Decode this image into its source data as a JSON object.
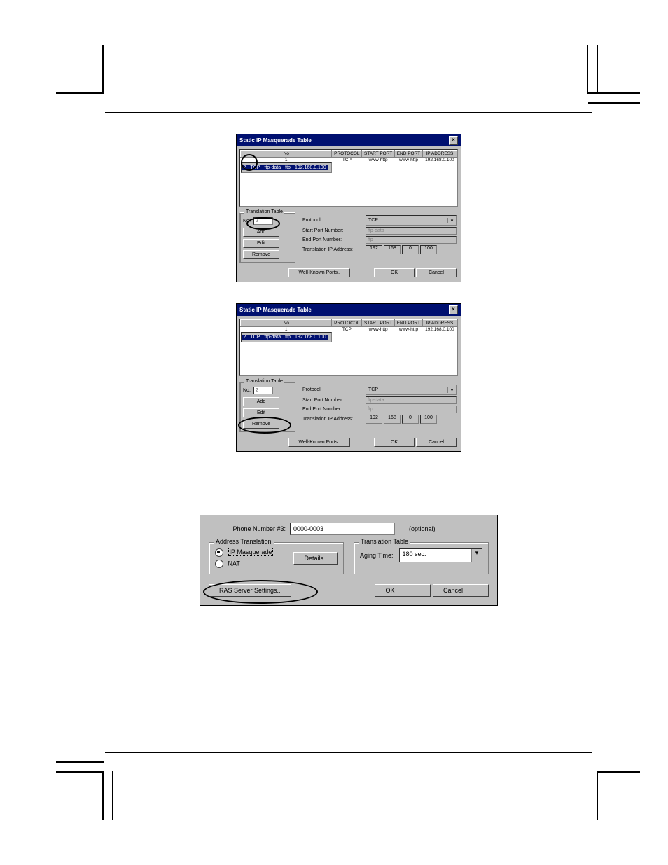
{
  "dialogTitle": "Static IP Masquerade Table",
  "columns": {
    "no": "No",
    "proto": "PROTOCOL",
    "sport": "START PORT",
    "eport": "END PORT",
    "ip": "IP ADDRESS"
  },
  "rows": [
    {
      "no": "1",
      "proto": "TCP",
      "sport": "www-http",
      "eport": "www-http",
      "ip": "192.168.0.100"
    },
    {
      "no": "2",
      "proto": "TCP",
      "sport": "ftp-data",
      "eport": "ftp",
      "ip": "192.168.0.100"
    }
  ],
  "translationLegend": "Translation Table",
  "noLabel": "No.",
  "noValue": "2",
  "btns": {
    "add": "Add",
    "edit": "Edit",
    "remove": "Remove",
    "wkp": "Well-Known Ports..",
    "ok": "OK",
    "cancel": "Cancel"
  },
  "form": {
    "protoLabel": "Protocol:",
    "protoValue": "TCP",
    "spLabel": "Start Port Number:",
    "spValue": "ftp-data",
    "epLabel": "End Port Number:",
    "epValue": "ftp",
    "tipLabel": "Translation IP Address:",
    "ip1": "192",
    "ip2": "168",
    "ip3": "0",
    "ip4": "100"
  },
  "bottom": {
    "phoneLabel": "Phone Number #3:",
    "phoneValue": "0000-0003",
    "optional": "(optional)",
    "addrLegend": "Address Translation",
    "ipmasq": "IP Masquerade",
    "nat": "NAT",
    "details": "Details..",
    "transLegend": "Translation Table",
    "agingLabel": "Aging Time:",
    "agingValue": "180 sec.",
    "ras": "RAS Server Settings..",
    "ok": "OK",
    "cancel": "Cancel"
  }
}
